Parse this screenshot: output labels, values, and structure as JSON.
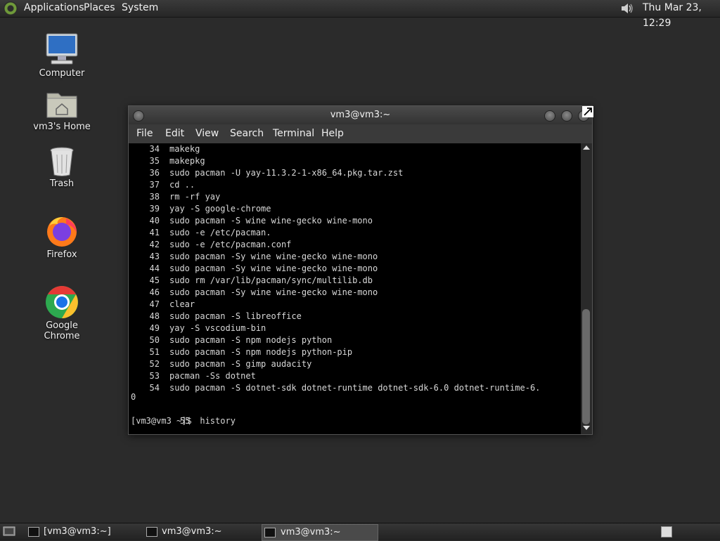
{
  "top_panel": {
    "menus": [
      "Applications",
      "Places",
      "System"
    ],
    "clock": "Thu Mar 23, 12:29"
  },
  "desktop": {
    "icons": [
      {
        "label": "Computer",
        "icon": "computer-icon"
      },
      {
        "label": "vm3's Home",
        "icon": "home-folder-icon"
      },
      {
        "label": "Trash",
        "icon": "trash-icon"
      },
      {
        "label": "Firefox",
        "icon": "firefox-icon"
      },
      {
        "label": "Google Chrome",
        "icon": "chrome-icon"
      }
    ]
  },
  "terminal": {
    "title": "vm3@vm3:~",
    "menu": [
      "File",
      "Edit",
      "View",
      "Search",
      "Terminal",
      "Help"
    ],
    "history": [
      {
        "num": "34",
        "cmd": "makekg"
      },
      {
        "num": "35",
        "cmd": "makepkg"
      },
      {
        "num": "36",
        "cmd": "sudo pacman -U yay-11.3.2-1-x86_64.pkg.tar.zst"
      },
      {
        "num": "37",
        "cmd": "cd .."
      },
      {
        "num": "38",
        "cmd": "rm -rf yay"
      },
      {
        "num": "39",
        "cmd": "yay -S google-chrome"
      },
      {
        "num": "40",
        "cmd": "sudo pacman -S wine wine-gecko wine-mono"
      },
      {
        "num": "41",
        "cmd": "sudo -e /etc/pacman."
      },
      {
        "num": "42",
        "cmd": "sudo -e /etc/pacman.conf"
      },
      {
        "num": "43",
        "cmd": "sudo pacman -Sy wine wine-gecko wine-mono"
      },
      {
        "num": "44",
        "cmd": "sudo pacman -Sy wine wine-gecko wine-mono"
      },
      {
        "num": "45",
        "cmd": "sudo rm /var/lib/pacman/sync/multilib.db"
      },
      {
        "num": "46",
        "cmd": "sudo pacman -Sy wine wine-gecko wine-mono"
      },
      {
        "num": "47",
        "cmd": "clear"
      },
      {
        "num": "48",
        "cmd": "sudo pacman -S libreoffice"
      },
      {
        "num": "49",
        "cmd": "yay -S vscodium-bin"
      },
      {
        "num": "50",
        "cmd": "sudo pacman -S npm nodejs python"
      },
      {
        "num": "51",
        "cmd": "sudo pacman -S npm nodejs python-pip"
      },
      {
        "num": "52",
        "cmd": "sudo pacman -S gimp audacity"
      },
      {
        "num": "53",
        "cmd": "pacman -Ss dotnet"
      },
      {
        "num": "54",
        "cmd": "sudo pacman -S dotnet-sdk dotnet-runtime dotnet-sdk-6.0 dotnet-runtime-6."
      }
    ],
    "wrap_line": "0",
    "last_entry": {
      "num": "55",
      "cmd": "history"
    },
    "prompt": "[vm3@vm3 ~]$"
  },
  "taskbar": {
    "tasks": [
      "[vm3@vm3:~]",
      "vm3@vm3:~",
      "vm3@vm3:~"
    ]
  },
  "colors": {
    "desktop_bg": "#2b2b2b",
    "terminal_bg": "#000000",
    "terminal_fg": "#d8d8d8"
  }
}
